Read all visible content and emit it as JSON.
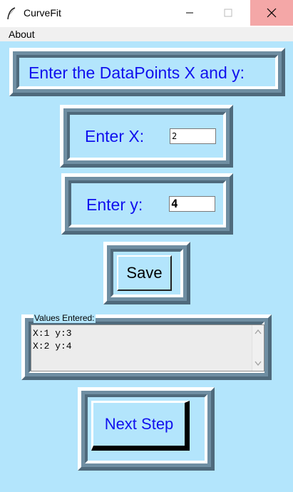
{
  "window": {
    "title": "CurveFit"
  },
  "menu": {
    "items": [
      "About"
    ]
  },
  "header": {
    "text": "Enter the DataPoints X and y:"
  },
  "x_input": {
    "label": "Enter X:",
    "value": "2"
  },
  "y_input": {
    "label": "Enter y:",
    "value": "4"
  },
  "save_button": {
    "label": "Save"
  },
  "values_group": {
    "legend": "Values Entered:",
    "lines": [
      "X:1 y:3",
      "X:2 y:4"
    ]
  },
  "next_button": {
    "label": "Next Step"
  },
  "colors": {
    "background": "#b3e5fc",
    "label_text": "#1010ee",
    "frame": "#6f8ea2",
    "close_hover": "#f4a7a7"
  },
  "icons": {
    "app": "feather-icon",
    "minimize": "minimize-icon",
    "maximize": "maximize-icon",
    "close": "close-icon",
    "scroll_up": "chevron-up-icon",
    "scroll_down": "chevron-down-icon"
  }
}
